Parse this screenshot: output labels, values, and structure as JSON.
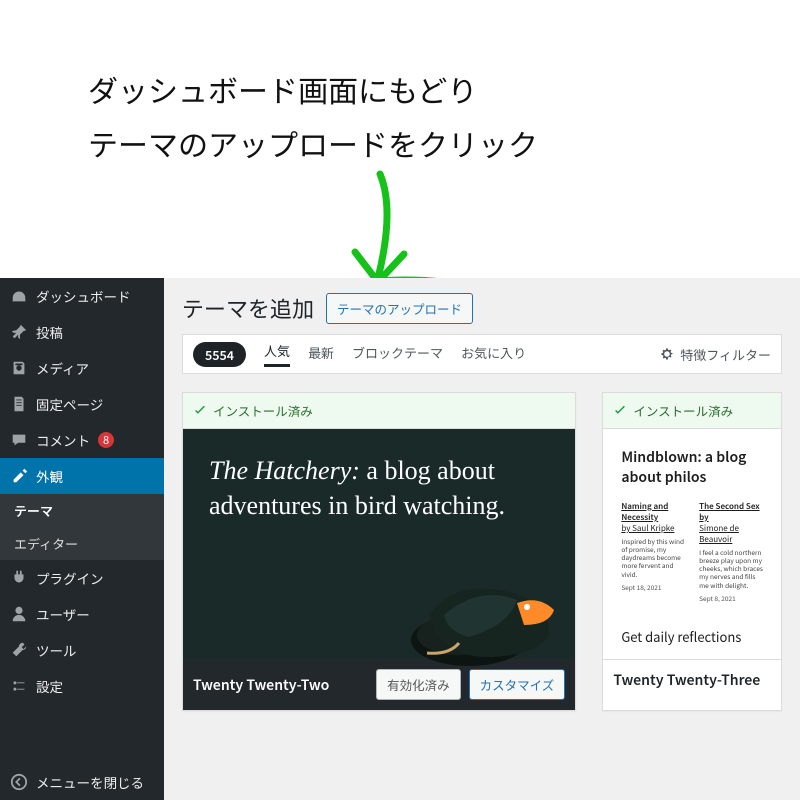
{
  "overlay": {
    "line1": "ダッシュボード画面にもどり",
    "line2": "テーマのアップロードをクリック"
  },
  "sidebar": {
    "items": [
      {
        "id": "dashboard",
        "label": "ダッシュボード"
      },
      {
        "id": "posts",
        "label": "投稿"
      },
      {
        "id": "media",
        "label": "メディア"
      },
      {
        "id": "pages",
        "label": "固定ページ"
      },
      {
        "id": "comments",
        "label": "コメント",
        "badge": "8"
      },
      {
        "id": "appearance",
        "label": "外観"
      },
      {
        "id": "plugins",
        "label": "プラグイン"
      },
      {
        "id": "users",
        "label": "ユーザー"
      },
      {
        "id": "tools",
        "label": "ツール"
      },
      {
        "id": "settings",
        "label": "設定"
      }
    ],
    "sub": {
      "themes": "テーマ",
      "editor": "エディター"
    },
    "collapse": "メニューを閉じる"
  },
  "page": {
    "title": "テーマを追加",
    "upload_btn": "テーマのアップロード"
  },
  "filter": {
    "count": "5554",
    "tabs": {
      "popular": "人気",
      "latest": "最新",
      "block": "ブロックテーマ",
      "favorites": "お気に入り"
    },
    "feature_filter": "特徴フィルター"
  },
  "cards": {
    "installed": "インストール済み",
    "twenty22": {
      "name": "Twenty Twenty-Two",
      "activated": "有効化済み",
      "customize": "カスタマイズ",
      "hatchery_em": "The Hatchery:",
      "hatchery_rest": " a blog about adventures in bird watching."
    },
    "twenty23": {
      "name": "Twenty Twenty-Three",
      "head": "Mindblown: a blog about philos",
      "col1": {
        "title": "Naming and Necessity",
        "author": "by Saul Kripke",
        "blurb": "Inspired by this wind of promise, my daydreams become more fervent and vivid.",
        "date": "Sept 18, 2021"
      },
      "col2": {
        "title": "The Second Sex by",
        "author": "Simone de Beauvoir",
        "blurb": "I feel a cold northern breeze play upon my cheeks, which braces my nerves and fills me with delight.",
        "date": "Sept 8, 2021"
      },
      "daily": "Get daily reflections"
    }
  }
}
